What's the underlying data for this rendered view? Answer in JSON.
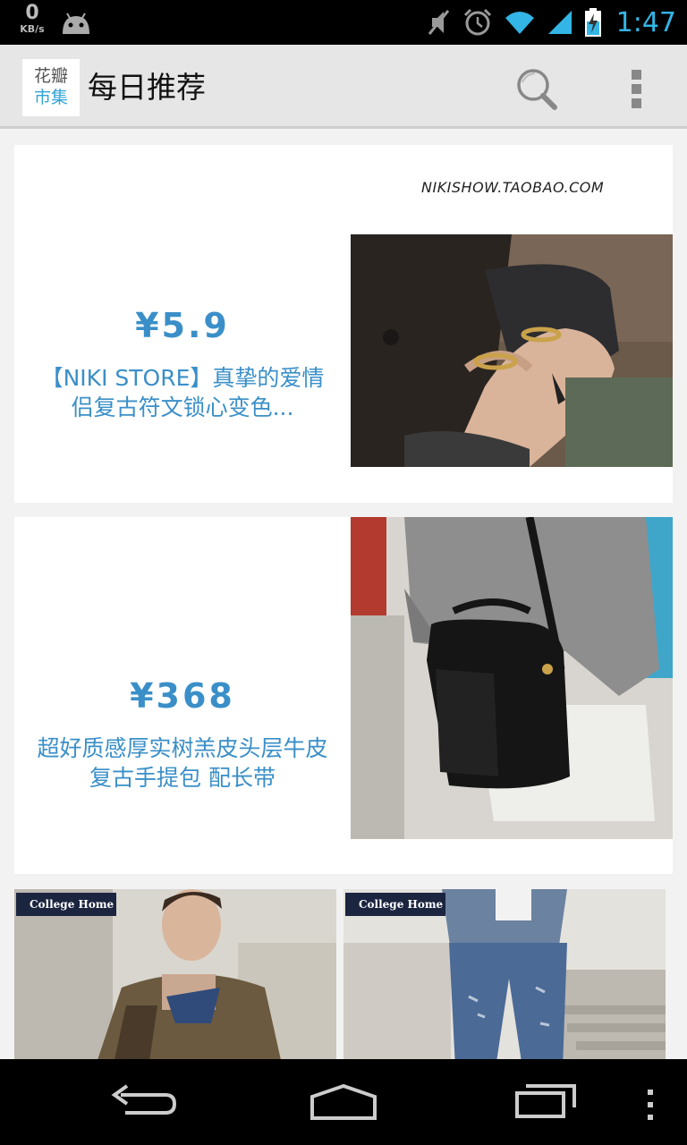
{
  "status_bar": {
    "net_speed_value": "0",
    "net_speed_unit": "KB/s",
    "time": "1:47",
    "icons": [
      "android-debug-icon",
      "mute-icon",
      "alarm-icon",
      "wifi-icon",
      "signal-icon",
      "battery-charging-icon"
    ]
  },
  "action_bar": {
    "logo_line1": "花瓣",
    "logo_line2": "市集",
    "title": "每日推荐",
    "icons": [
      "search-icon",
      "overflow-menu-icon"
    ]
  },
  "cards": [
    {
      "price": "¥5.9",
      "description": "【NIKI STORE】真挚的爱情侣复古符文锁心变色...",
      "watermark": "NIKISHOW.TAOBAO.COM",
      "image": "rings-on-hands-photo"
    },
    {
      "price": "¥368",
      "description": "超好质感厚实树羔皮头层牛皮复古手提包 配长带",
      "image": "black-leather-handbag-photo"
    }
  ],
  "tiles": [
    {
      "badge": "College Home",
      "image": "man-in-quilted-jacket-photo"
    },
    {
      "badge": "College Home",
      "image": "distressed-jeans-photo"
    }
  ],
  "nav_bar": {
    "icons": [
      "back-icon",
      "home-icon",
      "recent-apps-icon",
      "menu-icon"
    ]
  },
  "colors": {
    "accent": "#33b5e5",
    "price_blue": "#3a8fc8",
    "badge_navy": "#1b2540"
  }
}
